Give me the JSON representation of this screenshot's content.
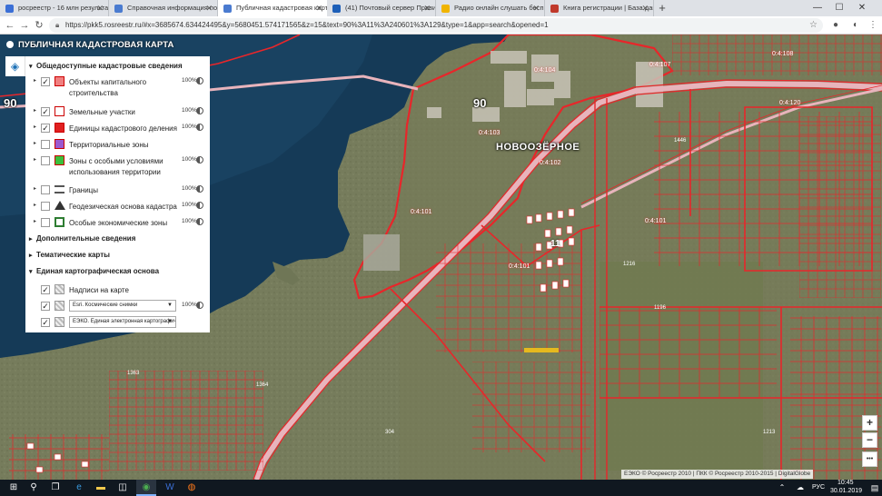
{
  "browser": {
    "tabs": [
      {
        "title": "росреестр - 16 млн результатов",
        "favicon_color": "#3b6fd6",
        "active": false
      },
      {
        "title": "Справочная информация по о",
        "favicon_color": "#4a7bd0",
        "active": false
      },
      {
        "title": "Публичная кадастровая карта",
        "favicon_color": "#4a7bd0",
        "active": true
      },
      {
        "title": "(41) Почтовый сервер Правит",
        "favicon_color": "#1d5fb8",
        "active": false
      },
      {
        "title": "Радио онлайн слушать бесп",
        "favicon_color": "#f0b400",
        "active": false
      },
      {
        "title": "Книга регистрации | База дан",
        "favicon_color": "#c0392b",
        "active": false
      }
    ],
    "url": "https://pkk5.rosreestr.ru/#x=3685674.634424495&y=5680451.574171565&z=15&text=90%3A11%3A240601%3A129&type=1&app=search&opened=1",
    "window_controls": {
      "minimize": "—",
      "maximize": "☐",
      "close": "✕"
    }
  },
  "app": {
    "title": "ПУБЛИЧНАЯ КАДАСТРОВАЯ КАРТА"
  },
  "layers": {
    "section_main": "Общедоступные кадастровые сведения",
    "items": [
      {
        "label": "Объекты капитального строительства",
        "checked": true,
        "percent": "100%",
        "symbol_color": "#f08080"
      },
      {
        "label": "Земельные участки",
        "checked": true,
        "percent": "100%",
        "symbol_color": "#ffffff"
      },
      {
        "label": "Единицы кадастрового деления",
        "checked": true,
        "percent": "100%",
        "symbol_color": "#e02020"
      },
      {
        "label": "Территориальные зоны",
        "checked": false,
        "percent": "",
        "symbol_color": "#9b59d0"
      },
      {
        "label": "Зоны с особыми условиями использования территории",
        "checked": false,
        "percent": "100%",
        "symbol_color": "#3cbf3c"
      },
      {
        "label": "Границы",
        "checked": false,
        "percent": "100%",
        "symbol_color": "#555555"
      },
      {
        "label": "Геодезическая основа кадастра",
        "checked": false,
        "percent": "100%",
        "symbol_color": "#333333"
      },
      {
        "label": "Особые экономические зоны",
        "checked": false,
        "percent": "100%",
        "symbol_color": "#2e7d32"
      }
    ],
    "section_additional": "Дополнительные сведения",
    "section_thematic": "Тематические карты",
    "section_base": "Единая картографическая основа",
    "base_items": [
      {
        "label": "Надписи на карте",
        "checked": true,
        "percent": "",
        "type": "text"
      },
      {
        "label": "Esri. Космические снимки",
        "checked": true,
        "percent": "100%",
        "type": "select"
      },
      {
        "label": "ЕЭКО. Единая электронная картографическ",
        "checked": true,
        "percent": "",
        "type": "select"
      }
    ]
  },
  "map": {
    "place_name": "НОВООЗЁРНОЕ",
    "road_number": "90",
    "road_number_left": "90",
    "block_labels": [
      "0:4:103",
      "0:4:104",
      "0:4:107",
      "0:4:108",
      "0:4:102",
      "0:4:101",
      "0:4:101",
      "0:4:120",
      "0:4:101",
      "0:4:121"
    ],
    "parcel_numbers": [
      "11",
      "1446",
      "1363",
      "1364",
      "304",
      "1216",
      "1196",
      "1213"
    ],
    "colors": {
      "water": "#153a57",
      "land": "#6f7656",
      "parcel_line": "#e8262a",
      "road": "#e8b4bc"
    }
  },
  "zoom": {
    "plus": "+",
    "minus": "−",
    "more": "•••"
  },
  "attribution": "ЕЭКО © Росреестр 2010 | ПКК © Росреестр 2010-2015 | DigitalGlobe",
  "taskbar": {
    "lang": "РУС",
    "time": "10:45",
    "date": "30.01.2019"
  }
}
